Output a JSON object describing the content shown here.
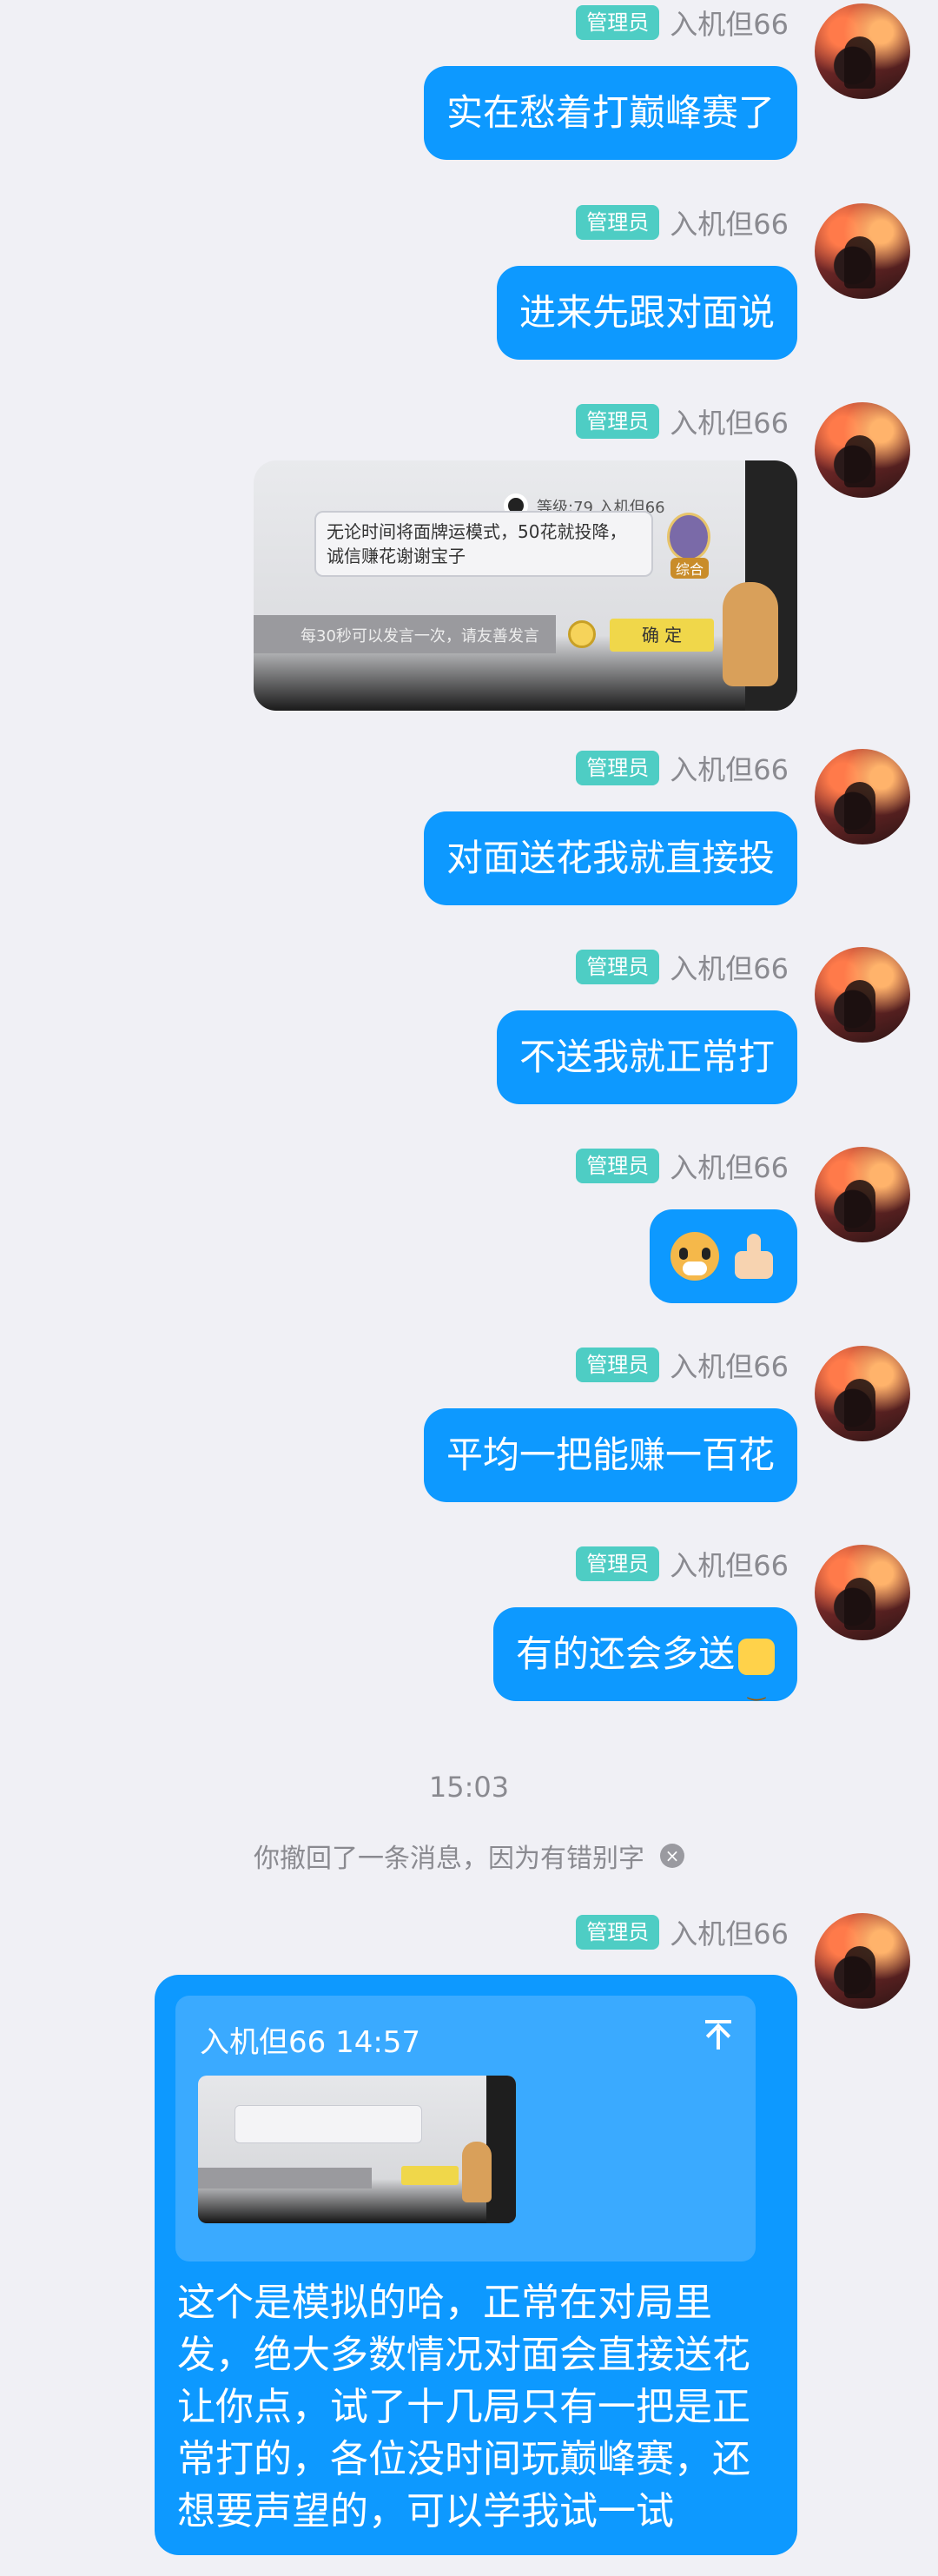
{
  "sender": {
    "role_badge": "管理员",
    "nickname": "入机但66"
  },
  "messages": [
    {
      "text": "实在愁着打巅峰赛了"
    },
    {
      "text": "进来先跟对面说"
    },
    {
      "image": {
        "level_text": "等级:79 入机但66",
        "chat_text": "无论时间将面牌运模式，50花就投降，诚信赚花谢谢宝子",
        "tag": "综合",
        "input_hint": "每30秒可以发言一次，请友善发言",
        "confirm": "确 定"
      }
    },
    {
      "text": "对面送花我就直接投"
    },
    {
      "text": "不送我就正常打"
    },
    {
      "sticker": "🐱👍"
    },
    {
      "text": "平均一把能赚一百花"
    },
    {
      "text": "有的还会多送"
    }
  ],
  "timestamp": "15:03",
  "system_message": "你撤回了一条消息，因为有错别字",
  "reply": {
    "quoted_header": "入机但66 14:57",
    "text": "这个是模拟的哈，正常在对局里发，绝大多数情况对面会直接送花让你点，试了十几局只有一把是正常打的，各位没时间玩巅峰赛，还想要声望的，可以学我试一试"
  },
  "colors": {
    "bubble": "#0d99ff",
    "badge": "#4ecdc4",
    "background": "#f0f0f5"
  }
}
